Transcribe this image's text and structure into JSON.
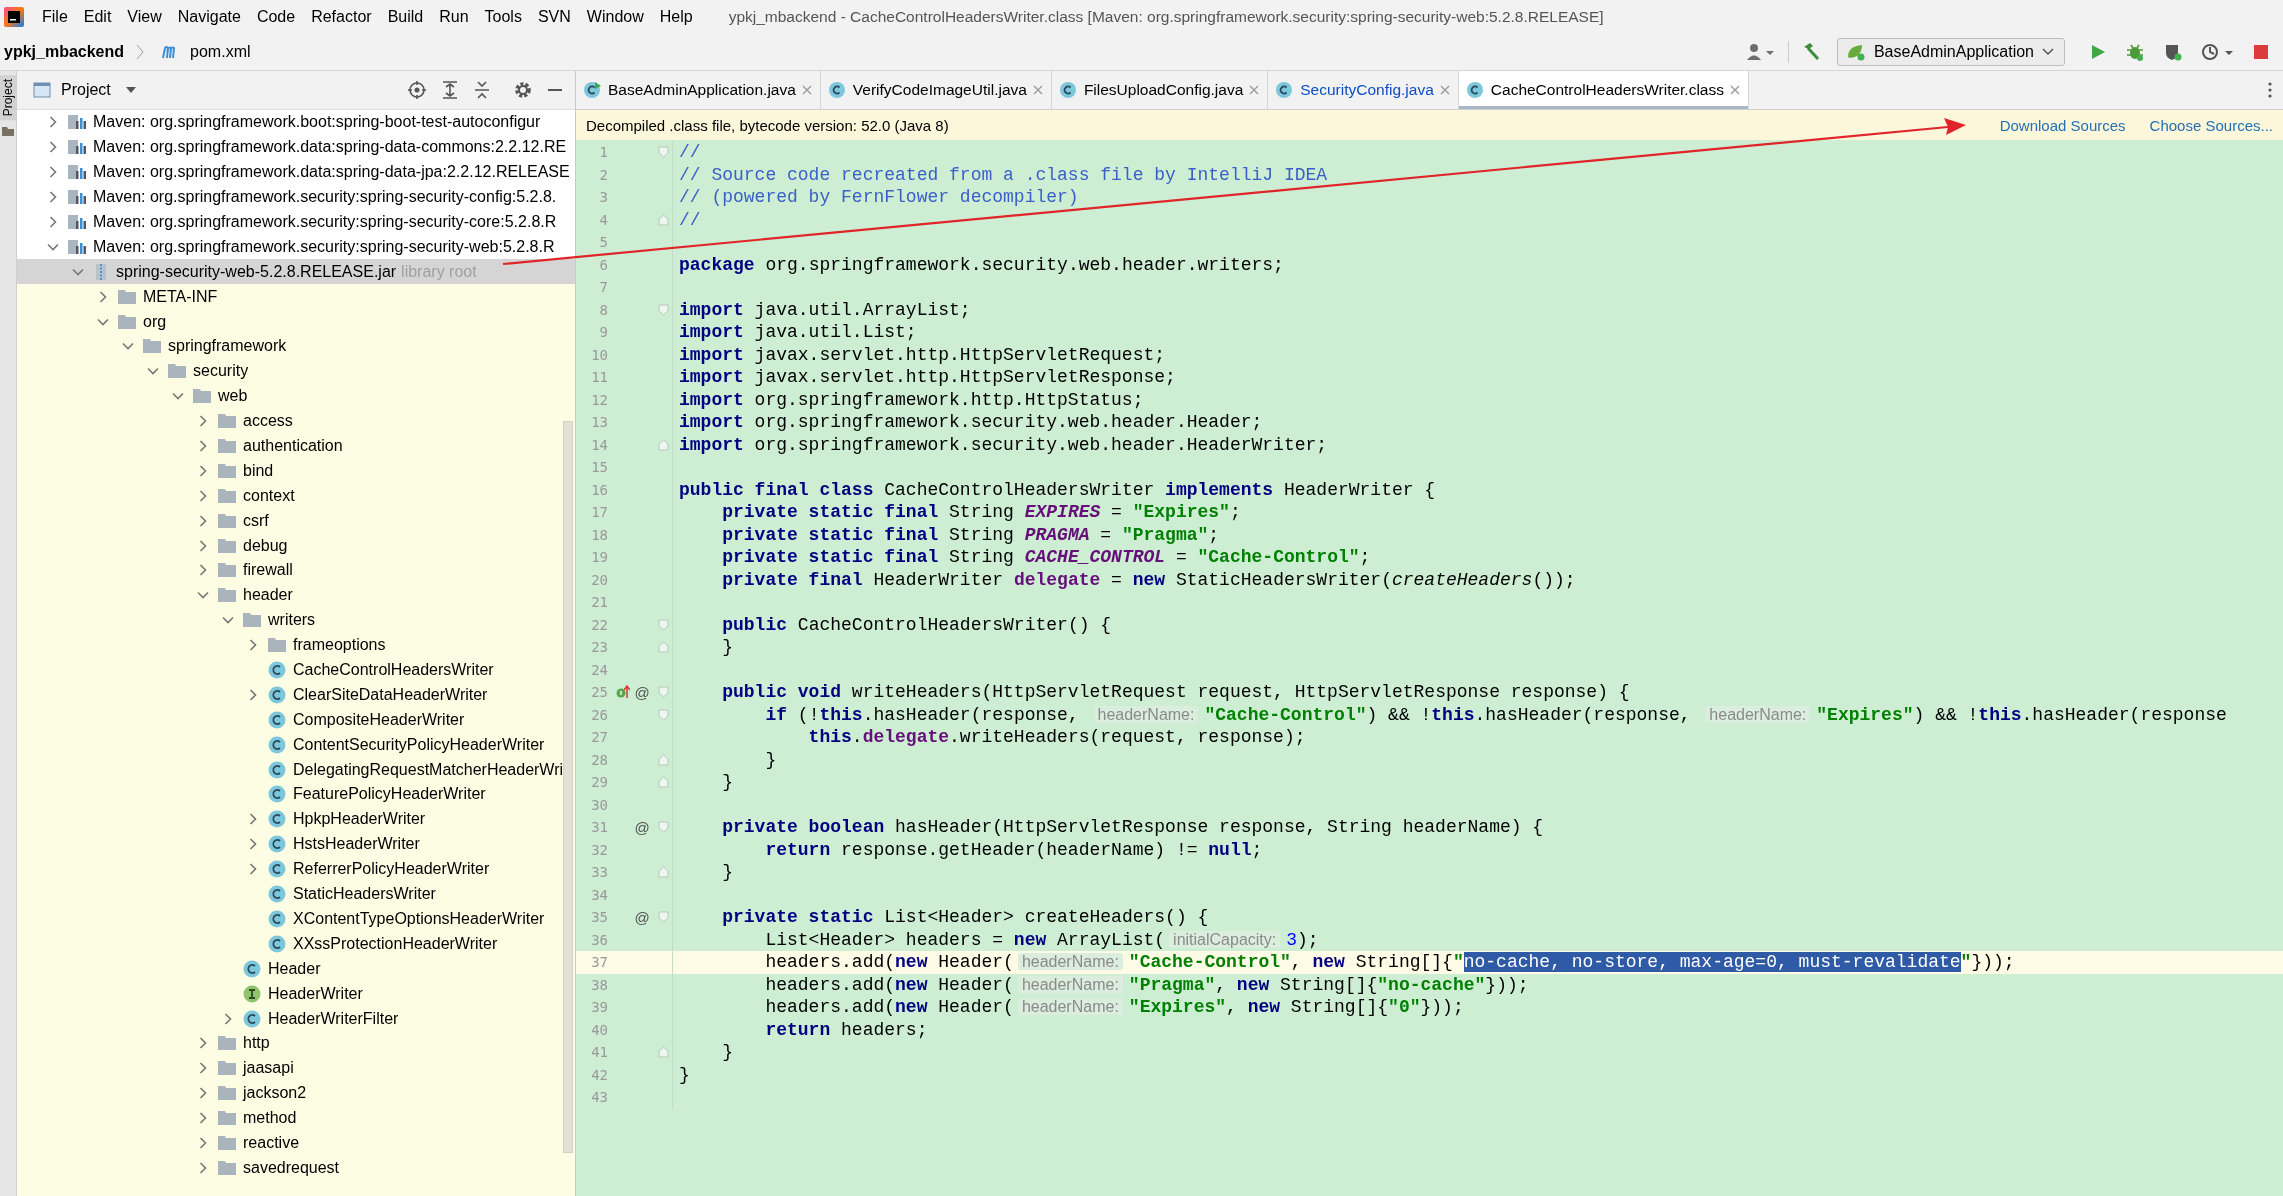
{
  "menu": [
    "File",
    "Edit",
    "View",
    "Navigate",
    "Code",
    "Refactor",
    "Build",
    "Run",
    "Tools",
    "SVN",
    "Window",
    "Help"
  ],
  "window": {
    "title": "ypkj_mbackend - CacheControlHeadersWriter.class [Maven: org.springframework.security:spring-security-web:5.2.8.RELEASE]"
  },
  "breadcrumb": {
    "project": "ypkj_mbackend",
    "file": "pom.xml"
  },
  "run_config": {
    "label": "BaseAdminApplication"
  },
  "side_strip": {
    "label": "Project"
  },
  "project": {
    "title": "Project",
    "tree": [
      {
        "label": "Maven: org.springframework.boot:spring-boot-test-autoconfigur",
        "kind": "maven",
        "expanded": false,
        "selected": false
      },
      {
        "label": "Maven: org.springframework.data:spring-data-commons:2.2.12.RE",
        "kind": "maven",
        "expanded": false,
        "selected": false
      },
      {
        "label": "Maven: org.springframework.data:spring-data-jpa:2.2.12.RELEASE",
        "kind": "maven",
        "expanded": false,
        "selected": false
      },
      {
        "label": "Maven: org.springframework.security:spring-security-config:5.2.8.",
        "kind": "maven",
        "expanded": false,
        "selected": false
      },
      {
        "label": "Maven: org.springframework.security:spring-security-core:5.2.8.R",
        "kind": "maven",
        "expanded": false,
        "selected": false
      },
      {
        "label": "Maven: org.springframework.security:spring-security-web:5.2.8.R",
        "kind": "maven",
        "expanded": true,
        "selected": false,
        "children": [
          {
            "label": "spring-security-web-5.2.8.RELEASE.jar",
            "hint": "library root",
            "kind": "jar",
            "expanded": true,
            "selected": true,
            "children": [
              {
                "label": "META-INF",
                "kind": "folder",
                "expanded": false,
                "selected": false
              },
              {
                "label": "org",
                "kind": "folder",
                "expanded": true,
                "selected": false,
                "children": [
                  {
                    "label": "springframework",
                    "kind": "folder",
                    "expanded": true,
                    "selected": false,
                    "children": [
                      {
                        "label": "security",
                        "kind": "folder",
                        "expanded": true,
                        "selected": false,
                        "children": [
                          {
                            "label": "web",
                            "kind": "folder",
                            "expanded": true,
                            "selected": false,
                            "children": [
                              {
                                "label": "access",
                                "kind": "folder",
                                "expanded": false,
                                "selected": false
                              },
                              {
                                "label": "authentication",
                                "kind": "folder",
                                "expanded": false,
                                "selected": false
                              },
                              {
                                "label": "bind",
                                "kind": "folder",
                                "expanded": false,
                                "selected": false
                              },
                              {
                                "label": "context",
                                "kind": "folder",
                                "expanded": false,
                                "selected": false
                              },
                              {
                                "label": "csrf",
                                "kind": "folder",
                                "expanded": false,
                                "selected": false
                              },
                              {
                                "label": "debug",
                                "kind": "folder",
                                "expanded": false,
                                "selected": false
                              },
                              {
                                "label": "firewall",
                                "kind": "folder",
                                "expanded": false,
                                "selected": false
                              },
                              {
                                "label": "header",
                                "kind": "folder",
                                "expanded": true,
                                "selected": false,
                                "children": [
                                  {
                                    "label": "writers",
                                    "kind": "folder",
                                    "expanded": true,
                                    "selected": false,
                                    "children": [
                                      {
                                        "label": "frameoptions",
                                        "kind": "folder",
                                        "expanded": false,
                                        "selected": false
                                      },
                                      {
                                        "label": "CacheControlHeadersWriter",
                                        "kind": "class",
                                        "selected": false
                                      },
                                      {
                                        "label": "ClearSiteDataHeaderWriter",
                                        "kind": "class",
                                        "expanded": false,
                                        "selected": false
                                      },
                                      {
                                        "label": "CompositeHeaderWriter",
                                        "kind": "class",
                                        "selected": false
                                      },
                                      {
                                        "label": "ContentSecurityPolicyHeaderWriter",
                                        "kind": "class",
                                        "selected": false
                                      },
                                      {
                                        "label": "DelegatingRequestMatcherHeaderWri",
                                        "kind": "class",
                                        "selected": false
                                      },
                                      {
                                        "label": "FeaturePolicyHeaderWriter",
                                        "kind": "class",
                                        "selected": false
                                      },
                                      {
                                        "label": "HpkpHeaderWriter",
                                        "kind": "class",
                                        "expanded": false,
                                        "selected": false
                                      },
                                      {
                                        "label": "HstsHeaderWriter",
                                        "kind": "class",
                                        "expanded": false,
                                        "selected": false
                                      },
                                      {
                                        "label": "ReferrerPolicyHeaderWriter",
                                        "kind": "class",
                                        "expanded": false,
                                        "selected": false
                                      },
                                      {
                                        "label": "StaticHeadersWriter",
                                        "kind": "class",
                                        "selected": false
                                      },
                                      {
                                        "label": "XContentTypeOptionsHeaderWriter",
                                        "kind": "class",
                                        "selected": false
                                      },
                                      {
                                        "label": "XXssProtectionHeaderWriter",
                                        "kind": "class",
                                        "selected": false
                                      }
                                    ]
                                  },
                                  {
                                    "label": "Header",
                                    "kind": "class",
                                    "selected": false
                                  },
                                  {
                                    "label": "HeaderWriter",
                                    "kind": "interface",
                                    "selected": false
                                  },
                                  {
                                    "label": "HeaderWriterFilter",
                                    "kind": "class",
                                    "expanded": false,
                                    "selected": false
                                  }
                                ]
                              },
                              {
                                "label": "http",
                                "kind": "folder",
                                "expanded": false,
                                "selected": false
                              },
                              {
                                "label": "jaasapi",
                                "kind": "folder",
                                "expanded": false,
                                "selected": false
                              },
                              {
                                "label": "jackson2",
                                "kind": "folder",
                                "expanded": false,
                                "selected": false
                              },
                              {
                                "label": "method",
                                "kind": "folder",
                                "expanded": false,
                                "selected": false
                              },
                              {
                                "label": "reactive",
                                "kind": "folder",
                                "expanded": false,
                                "selected": false
                              },
                              {
                                "label": "savedrequest",
                                "kind": "folder",
                                "expanded": false,
                                "selected": false
                              }
                            ]
                          }
                        ]
                      }
                    ]
                  }
                ]
              }
            ]
          }
        ]
      }
    ]
  },
  "tabs": [
    {
      "label": "BaseAdminApplication.java",
      "kind": "app",
      "color": "#000000",
      "selected": false
    },
    {
      "label": "VerifyCodeImageUtil.java",
      "kind": "class",
      "color": "#000000",
      "selected": false
    },
    {
      "label": "FilesUploadConfig.java",
      "kind": "class",
      "color": "#000000",
      "selected": false
    },
    {
      "label": "SecurityConfig.java",
      "kind": "class",
      "color": "#0b4fc4",
      "selected": false
    },
    {
      "label": "CacheControlHeadersWriter.class",
      "kind": "class",
      "color": "#000000",
      "selected": true
    }
  ],
  "notice": {
    "text": "Decompiled .class file, bytecode version: 52.0 (Java 8)",
    "links": [
      "Download Sources",
      "Choose Sources..."
    ]
  },
  "code": [
    {
      "n": "1",
      "current": false,
      "fold": {
        "kind": "start"
      },
      "tokens": [
        {
          "kind": "comment",
          "text": "//"
        }
      ]
    },
    {
      "n": "2",
      "current": false,
      "tokens": [
        {
          "kind": "comment",
          "text": "// Source code recreated from a .class file by IntelliJ IDEA"
        }
      ]
    },
    {
      "n": "3",
      "current": false,
      "tokens": [
        {
          "kind": "comment",
          "text": "// (powered by FernFlower decompiler)"
        }
      ]
    },
    {
      "n": "4",
      "current": false,
      "fold": {
        "kind": "end"
      },
      "tokens": [
        {
          "kind": "comment",
          "text": "//"
        }
      ]
    },
    {
      "n": "5",
      "current": false
    },
    {
      "n": "6",
      "current": false,
      "tokens": [
        {
          "kind": "kw",
          "text": "package"
        },
        {
          "kind": "plain",
          "text": " org.springframework.security.web.header.writers;"
        }
      ]
    },
    {
      "n": "7",
      "current": false
    },
    {
      "n": "8",
      "current": false,
      "fold": {
        "kind": "start"
      },
      "tokens": [
        {
          "kind": "kw",
          "text": "import"
        },
        {
          "kind": "plain",
          "text": " java.util.ArrayList;"
        }
      ]
    },
    {
      "n": "9",
      "current": false,
      "tokens": [
        {
          "kind": "kw",
          "text": "import"
        },
        {
          "kind": "plain",
          "text": " java.util.List;"
        }
      ]
    },
    {
      "n": "10",
      "current": false,
      "tokens": [
        {
          "kind": "kw",
          "text": "import"
        },
        {
          "kind": "plain",
          "text": " javax.servlet.http.HttpServletRequest;"
        }
      ]
    },
    {
      "n": "11",
      "current": false,
      "tokens": [
        {
          "kind": "kw",
          "text": "import"
        },
        {
          "kind": "plain",
          "text": " javax.servlet.http.HttpServletResponse;"
        }
      ]
    },
    {
      "n": "12",
      "current": false,
      "tokens": [
        {
          "kind": "kw",
          "text": "import"
        },
        {
          "kind": "plain",
          "text": " org.springframework.http.HttpStatus;"
        }
      ]
    },
    {
      "n": "13",
      "current": false,
      "tokens": [
        {
          "kind": "kw",
          "text": "import"
        },
        {
          "kind": "plain",
          "text": " org.springframework.security.web.header.Header;"
        }
      ]
    },
    {
      "n": "14",
      "current": false,
      "fold": {
        "kind": "end"
      },
      "tokens": [
        {
          "kind": "kw",
          "text": "import"
        },
        {
          "kind": "plain",
          "text": " org.springframework.security.web.header.HeaderWriter;"
        }
      ]
    },
    {
      "n": "15",
      "current": false
    },
    {
      "n": "16",
      "current": false,
      "tokens": [
        {
          "kind": "kw",
          "text": "public final class"
        },
        {
          "kind": "plain",
          "text": " CacheControlHeadersWriter "
        },
        {
          "kind": "kw",
          "text": "implements"
        },
        {
          "kind": "plain",
          "text": " HeaderWriter {"
        }
      ]
    },
    {
      "n": "17",
      "current": false,
      "tokens": [
        {
          "kind": "kw",
          "text": "    private static final"
        },
        {
          "kind": "plain",
          "text": " String "
        },
        {
          "kind": "const",
          "text": "EXPIRES"
        },
        {
          "kind": "plain",
          "text": " = "
        },
        {
          "kind": "str",
          "text": "\"Expires\""
        },
        {
          "kind": "plain",
          "text": ";"
        }
      ]
    },
    {
      "n": "18",
      "current": false,
      "tokens": [
        {
          "kind": "kw",
          "text": "    private static final"
        },
        {
          "kind": "plain",
          "text": " String "
        },
        {
          "kind": "const",
          "text": "PRAGMA"
        },
        {
          "kind": "plain",
          "text": " = "
        },
        {
          "kind": "str",
          "text": "\"Pragma\""
        },
        {
          "kind": "plain",
          "text": ";"
        }
      ]
    },
    {
      "n": "19",
      "current": false,
      "tokens": [
        {
          "kind": "kw",
          "text": "    private static final"
        },
        {
          "kind": "plain",
          "text": " String "
        },
        {
          "kind": "const",
          "text": "CACHE_CONTROL"
        },
        {
          "kind": "plain",
          "text": " = "
        },
        {
          "kind": "str",
          "text": "\"Cache-Control\""
        },
        {
          "kind": "plain",
          "text": ";"
        }
      ]
    },
    {
      "n": "20",
      "current": false,
      "tokens": [
        {
          "kind": "kw",
          "text": "    private final"
        },
        {
          "kind": "plain",
          "text": " HeaderWriter "
        },
        {
          "kind": "field",
          "text": "delegate"
        },
        {
          "kind": "plain",
          "text": " = "
        },
        {
          "kind": "kw",
          "text": "new"
        },
        {
          "kind": "plain",
          "text": " StaticHeadersWriter("
        },
        {
          "kind": "italic",
          "text": "createHeaders"
        },
        {
          "kind": "plain",
          "text": "());"
        }
      ]
    },
    {
      "n": "21",
      "current": false
    },
    {
      "n": "22",
      "current": false,
      "fold": {
        "kind": "start"
      },
      "tokens": [
        {
          "kind": "kw",
          "text": "    public"
        },
        {
          "kind": "plain",
          "text": " CacheControlHeadersWriter() {"
        }
      ]
    },
    {
      "n": "23",
      "current": false,
      "fold": {
        "kind": "end"
      },
      "tokens": [
        {
          "kind": "plain",
          "text": "    }"
        }
      ]
    },
    {
      "n": "24",
      "current": false
    },
    {
      "n": "25",
      "current": false,
      "marker": {
        "kind": "implements"
      },
      "annotation": "@",
      "fold": {
        "kind": "start"
      },
      "tokens": [
        {
          "kind": "kw",
          "text": "    public void"
        },
        {
          "kind": "plain",
          "text": " writeHeaders(HttpServletRequest request, HttpServletResponse response) {"
        }
      ]
    },
    {
      "n": "26",
      "current": false,
      "fold": {
        "kind": "start"
      },
      "tokens": [
        {
          "kind": "kw",
          "text": "        if"
        },
        {
          "kind": "plain",
          "text": " (!"
        },
        {
          "kind": "kw",
          "text": "this"
        },
        {
          "kind": "plain",
          "text": ".hasHeader(response, "
        },
        {
          "kind": "hint",
          "text": "headerName:"
        },
        {
          "kind": "str",
          "text": "\"Cache-Control\""
        },
        {
          "kind": "plain",
          "text": ") && !"
        },
        {
          "kind": "kw",
          "text": "this"
        },
        {
          "kind": "plain",
          "text": ".hasHeader(response, "
        },
        {
          "kind": "hint",
          "text": "headerName:"
        },
        {
          "kind": "str",
          "text": "\"Expires\""
        },
        {
          "kind": "plain",
          "text": ") && !"
        },
        {
          "kind": "kw",
          "text": "this"
        },
        {
          "kind": "plain",
          "text": ".hasHeader(response"
        }
      ]
    },
    {
      "n": "27",
      "current": false,
      "tokens": [
        {
          "kind": "kw",
          "text": "            this"
        },
        {
          "kind": "plain",
          "text": "."
        },
        {
          "kind": "field",
          "text": "delegate"
        },
        {
          "kind": "plain",
          "text": ".writeHeaders(request, response);"
        }
      ]
    },
    {
      "n": "28",
      "current": false,
      "fold": {
        "kind": "end"
      },
      "tokens": [
        {
          "kind": "plain",
          "text": "        }"
        }
      ]
    },
    {
      "n": "29",
      "current": false,
      "fold": {
        "kind": "end"
      },
      "tokens": [
        {
          "kind": "plain",
          "text": "    }"
        }
      ]
    },
    {
      "n": "30",
      "current": false
    },
    {
      "n": "31",
      "current": false,
      "annotation": "@",
      "fold": {
        "kind": "start"
      },
      "tokens": [
        {
          "kind": "kw",
          "text": "    private boolean"
        },
        {
          "kind": "plain",
          "text": " hasHeader(HttpServletResponse response, String headerName) {"
        }
      ]
    },
    {
      "n": "32",
      "current": false,
      "tokens": [
        {
          "kind": "kw",
          "text": "        return"
        },
        {
          "kind": "plain",
          "text": " response.getHeader(headerName) != "
        },
        {
          "kind": "kw",
          "text": "null"
        },
        {
          "kind": "plain",
          "text": ";"
        }
      ]
    },
    {
      "n": "33",
      "current": false,
      "fold": {
        "kind": "end"
      },
      "tokens": [
        {
          "kind": "plain",
          "text": "    }"
        }
      ]
    },
    {
      "n": "34",
      "current": false
    },
    {
      "n": "35",
      "current": false,
      "annotation": "@",
      "fold": {
        "kind": "start"
      },
      "tokens": [
        {
          "kind": "kw",
          "text": "    private static"
        },
        {
          "kind": "plain",
          "text": " List<Header> createHeaders() {"
        }
      ]
    },
    {
      "n": "36",
      "current": false,
      "tokens": [
        {
          "kind": "plain",
          "text": "        List<Header> headers = "
        },
        {
          "kind": "kw",
          "text": "new"
        },
        {
          "kind": "plain",
          "text": " ArrayList("
        },
        {
          "kind": "hint",
          "text": "initialCapacity:"
        },
        {
          "kind": "num",
          "text": "3"
        },
        {
          "kind": "plain",
          "text": ");"
        }
      ]
    },
    {
      "n": "37",
      "current": true,
      "tokens": [
        {
          "kind": "plain",
          "text": "        headers.add("
        },
        {
          "kind": "kw",
          "text": "new"
        },
        {
          "kind": "plain",
          "text": " Header("
        },
        {
          "kind": "hint",
          "text": "headerName:"
        },
        {
          "kind": "str",
          "text": "\"Cache-Control\""
        },
        {
          "kind": "plain",
          "text": ", "
        },
        {
          "kind": "kw",
          "text": "new"
        },
        {
          "kind": "plain",
          "text": " String[]{"
        },
        {
          "kind": "str",
          "text": "\""
        },
        {
          "kind": "selected",
          "text": "no-cache, no-store, max-age=0, must-revalidate"
        },
        {
          "kind": "str",
          "text": "\""
        },
        {
          "kind": "plain",
          "text": "}));"
        }
      ]
    },
    {
      "n": "38",
      "current": false,
      "tokens": [
        {
          "kind": "plain",
          "text": "        headers.add("
        },
        {
          "kind": "kw",
          "text": "new"
        },
        {
          "kind": "plain",
          "text": " Header("
        },
        {
          "kind": "hint",
          "text": "headerName:"
        },
        {
          "kind": "str",
          "text": "\"Pragma\""
        },
        {
          "kind": "plain",
          "text": ", "
        },
        {
          "kind": "kw",
          "text": "new"
        },
        {
          "kind": "plain",
          "text": " String[]{"
        },
        {
          "kind": "str",
          "text": "\"no-cache\""
        },
        {
          "kind": "plain",
          "text": "}));"
        }
      ]
    },
    {
      "n": "39",
      "current": false,
      "tokens": [
        {
          "kind": "plain",
          "text": "        headers.add("
        },
        {
          "kind": "kw",
          "text": "new"
        },
        {
          "kind": "plain",
          "text": " Header("
        },
        {
          "kind": "hint",
          "text": "headerName:"
        },
        {
          "kind": "str",
          "text": "\"Expires\""
        },
        {
          "kind": "plain",
          "text": ", "
        },
        {
          "kind": "kw",
          "text": "new"
        },
        {
          "kind": "plain",
          "text": " String[]{"
        },
        {
          "kind": "str",
          "text": "\"0\""
        },
        {
          "kind": "plain",
          "text": "}));"
        }
      ]
    },
    {
      "n": "40",
      "current": false,
      "tokens": [
        {
          "kind": "kw",
          "text": "        return"
        },
        {
          "kind": "plain",
          "text": " headers;"
        }
      ]
    },
    {
      "n": "41",
      "current": false,
      "fold": {
        "kind": "end"
      },
      "tokens": [
        {
          "kind": "plain",
          "text": "    }"
        }
      ]
    },
    {
      "n": "42",
      "current": false,
      "tokens": [
        {
          "kind": "plain",
          "text": "}"
        }
      ]
    },
    {
      "n": "43",
      "current": false
    }
  ]
}
